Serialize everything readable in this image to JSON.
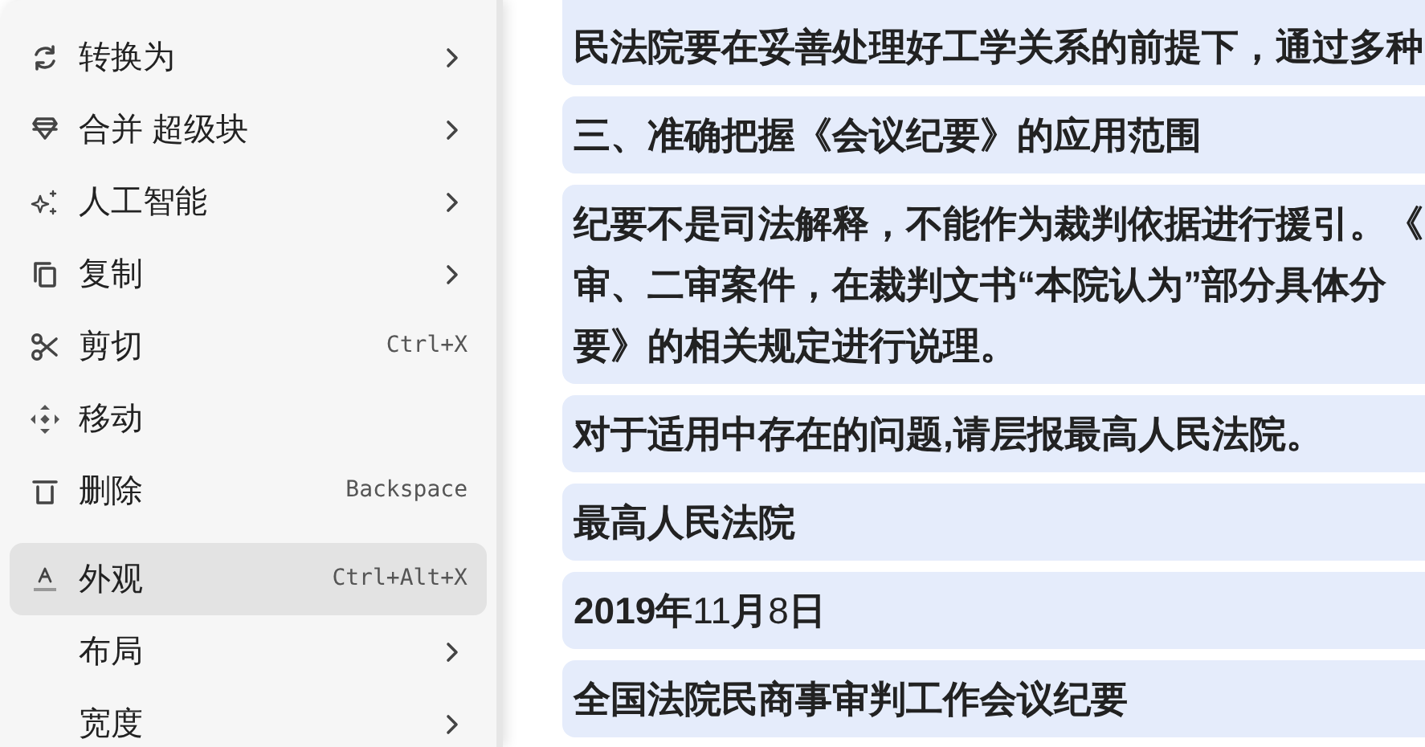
{
  "context_menu": {
    "items": [
      {
        "kind": "item",
        "label": "转换为",
        "submenu": true,
        "selected": false
      },
      {
        "kind": "item",
        "label": "合并 超级块",
        "submenu": true,
        "selected": false
      },
      {
        "kind": "item",
        "label": "人工智能",
        "submenu": true,
        "selected": false
      },
      {
        "kind": "item",
        "label": "复制",
        "submenu": true,
        "selected": false
      },
      {
        "kind": "item",
        "label": "剪切",
        "shortcut": "Ctrl+X",
        "selected": false
      },
      {
        "kind": "item",
        "label": "移动",
        "selected": false
      },
      {
        "kind": "item",
        "label": "删除",
        "shortcut": "Backspace",
        "selected": false
      },
      {
        "kind": "separator"
      },
      {
        "kind": "item",
        "label": "外观",
        "shortcut": "Ctrl+Alt+X",
        "selected": true
      },
      {
        "kind": "item",
        "label": "布局",
        "submenu": true,
        "selected": false
      },
      {
        "kind": "item",
        "label": "宽度",
        "submenu": true,
        "selected": false
      }
    ]
  },
  "document": {
    "blocks": [
      {
        "bold": true,
        "lines": [
          "民法院要在妥善处理好工学关系的前提下，通过多种"
        ]
      },
      {
        "bold": true,
        "lines": [
          "三、准确把握《会议纪要》的应用范围"
        ]
      },
      {
        "bold": true,
        "lines": [
          "纪要不是司法解释，不能作为裁判依据进行援引。《",
          "审、二审案件，在裁判文书“本院认为”部分具体分",
          "要》的相关规定进行说理。"
        ]
      },
      {
        "bold": true,
        "lines": [
          "对于适用中存在的问题,请层报最高人民法院。"
        ]
      },
      {
        "bold": true,
        "lines": [
          "最高人民法院"
        ]
      },
      {
        "bold": false,
        "lines": [
          "**2019年**11**月**8**日**"
        ]
      },
      {
        "bold": true,
        "lines": [
          "全国法院民商事审判工作会议纪要"
        ]
      }
    ]
  }
}
